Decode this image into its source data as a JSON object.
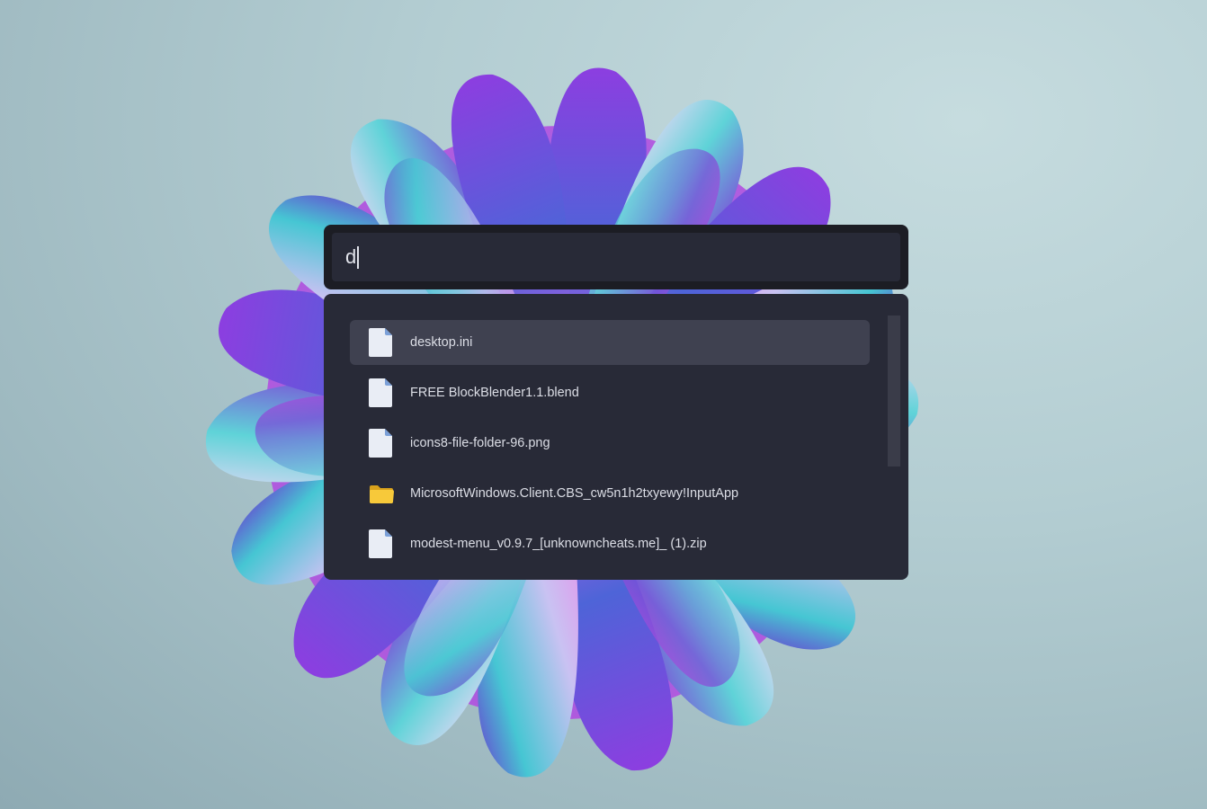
{
  "search": {
    "query": "d"
  },
  "results": [
    {
      "label": "desktop.ini",
      "icon": "file-icon",
      "selected": true
    },
    {
      "label": "FREE BlockBlender1.1.blend",
      "icon": "file-icon",
      "selected": false
    },
    {
      "label": "icons8-file-folder-96.png",
      "icon": "file-icon",
      "selected": false
    },
    {
      "label": "MicrosoftWindows.Client.CBS_cw5n1h2txyewy!InputApp",
      "icon": "folder-icon",
      "selected": false
    },
    {
      "label": "modest-menu_v0.9.7_[unknowncheats.me]_ (1).zip",
      "icon": "file-icon",
      "selected": false
    }
  ],
  "colors": {
    "panel_dark": "#1c1d24",
    "panel": "#282a37",
    "selected_row": "#3f4150",
    "text": "#dcdee6",
    "folder": "#f2c12e"
  }
}
